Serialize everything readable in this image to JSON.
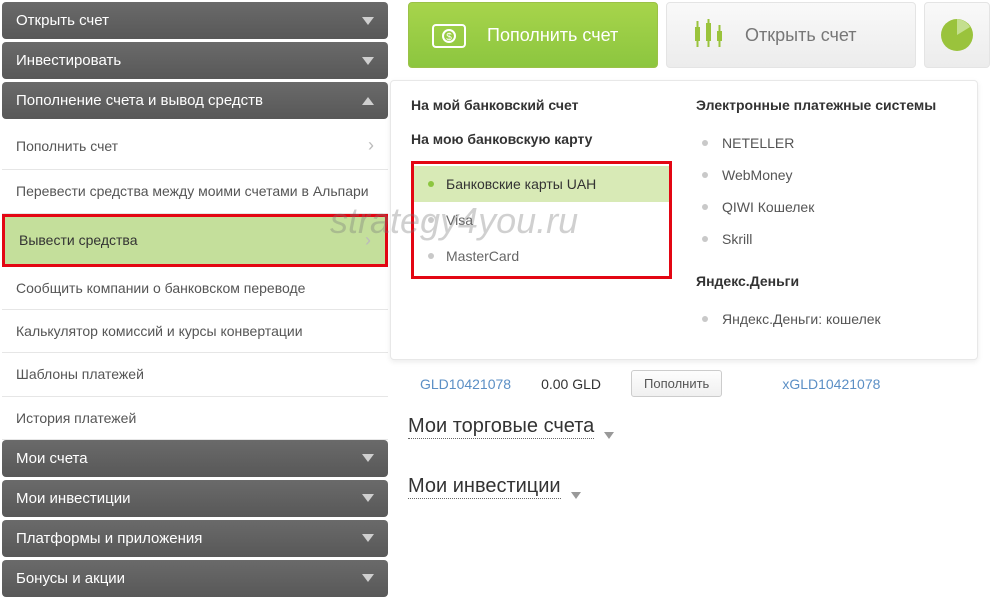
{
  "sidebar": {
    "headers": {
      "open_account": "Открыть счет",
      "invest": "Инвестировать",
      "deposit_withdraw": "Пополнение счета и вывод средств",
      "my_accounts": "Мои счета",
      "my_investments": "Мои инвестиции",
      "platforms": "Платформы и приложения",
      "bonuses": "Бонусы и акции"
    },
    "submenu": {
      "deposit": "Пополнить счет",
      "transfer": "Перевести средства между моими счетами в Альпари",
      "withdraw": "Вывести средства",
      "report_bank": "Сообщить компании о банковском переводе",
      "calc": "Калькулятор комиссий и курсы конвертации",
      "templates": "Шаблоны платежей",
      "history": "История платежей"
    }
  },
  "topbar": {
    "deposit_btn": "Пополнить счет",
    "open_btn": "Открыть счет"
  },
  "panel": {
    "col1": {
      "h1": "На мой банковский счет",
      "h2": "На мою банковскую карту",
      "items": {
        "uah": "Банковские карты UAH",
        "visa": "Visa",
        "mc": "MasterCard"
      }
    },
    "col2": {
      "h1": "Электронные платежные системы",
      "items": {
        "neteller": "NETELLER",
        "webmoney": "WebMoney",
        "qiwi": "QIWI Кошелек",
        "skrill": "Skrill"
      },
      "h2": "Яндекс.Деньги",
      "yandex": "Яндекс.Деньги: кошелек"
    }
  },
  "below": {
    "acct1": "GLD10421078",
    "balance": "0.00 GLD",
    "deposit_btn": "Пополнить",
    "acct2": "xGLD10421078",
    "sec1": "Мои торговые счета",
    "sec2": "Мои инвестиции"
  },
  "watermark": "strategy4you.ru"
}
